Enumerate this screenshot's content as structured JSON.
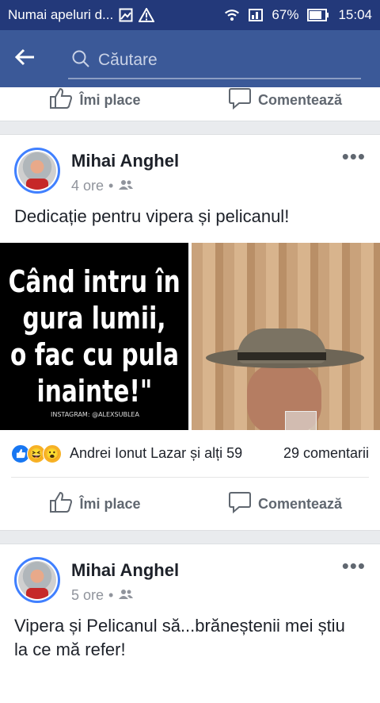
{
  "status_bar": {
    "carrier": "Numai apeluri d...",
    "battery_percent": "67%",
    "time": "15:04"
  },
  "search": {
    "placeholder": "Căutare"
  },
  "top_actions": {
    "like_label": "Îmi place",
    "comment_label": "Comentează"
  },
  "posts": [
    {
      "author": "Mihai Anghel",
      "time": "4 ore",
      "privacy_separator": "•",
      "text": "Dedicație pentru vipera și pelicanul!",
      "photo_caption_lines": [
        "Când intru în",
        "gura lumii,",
        "o fac cu pula",
        "inainte!\""
      ],
      "photo_credit": "INSTAGRAM: @ALEXSUBLEA",
      "reactions_text": "Andrei Ionut Lazar și alți 59",
      "comments_count": "29 comentarii",
      "like_label": "Îmi place",
      "comment_label": "Comentează"
    },
    {
      "author": "Mihai Anghel",
      "time": "5 ore",
      "privacy_separator": "•",
      "text": "Vipera și Pelicanul să...brăneștenii mei știu la ce mă refer!"
    }
  ],
  "colors": {
    "status_bar": "#23397a",
    "app_bar": "#3b5998",
    "accent": "#4080ff"
  }
}
